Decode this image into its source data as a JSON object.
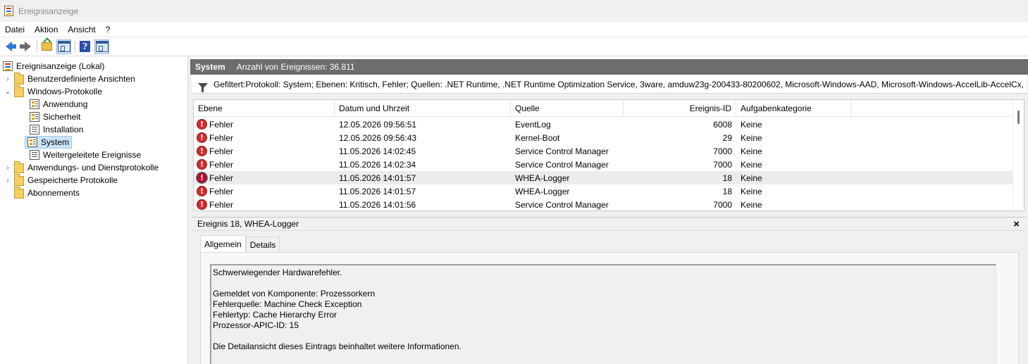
{
  "window": {
    "title": "Ereignisanzeige"
  },
  "menu": [
    "Datei",
    "Aktion",
    "Ansicht",
    "?"
  ],
  "toolbar": {
    "icons": [
      "back-arrow-icon",
      "forward-arrow-icon",
      "up-folder-icon",
      "show-hide-tree-icon",
      "help-icon",
      "action-pane-icon"
    ]
  },
  "tree": {
    "root": "Ereignisanzeige (Lokal)",
    "custom_views": "Benutzerdefinierte Ansichten",
    "windows_logs": "Windows-Protokolle",
    "logs": [
      "Anwendung",
      "Sicherheit",
      "Installation",
      "System",
      "Weitergeleitete Ereignisse"
    ],
    "app_service_logs": "Anwendungs- und Dienstprotokolle",
    "saved_logs": "Gespeicherte Protokolle",
    "subscriptions": "Abonnements"
  },
  "panel": {
    "title": "System",
    "count_label": "Anzahl von Ereignissen: 36.811",
    "filter_text": "Gefiltert:Protokoll: System; Ebenen: Kritisch, Fehler; Quellen: .NET Runtime, .NET Runtime Optimization Service, 3ware, amduw23g-200433-80200602, Microsoft-Windows-AAD, Microsoft-Windows-AccelLib-AccelCx,"
  },
  "table": {
    "columns": {
      "level": "Ebene",
      "datetime": "Datum und Uhrzeit",
      "source": "Quelle",
      "event_id": "Ereignis-ID",
      "category": "Aufgabenkategorie"
    },
    "rows": [
      {
        "level": "Fehler",
        "datetime": "12.05.2026 09:56:51",
        "source": "EventLog",
        "event_id": "6008",
        "category": "Keine"
      },
      {
        "level": "Fehler",
        "datetime": "12.05.2026 09:56:43",
        "source": "Kernel-Boot",
        "event_id": "29",
        "category": "Keine"
      },
      {
        "level": "Fehler",
        "datetime": "11.05.2026 14:02:45",
        "source": "Service Control Manager",
        "event_id": "7000",
        "category": "Keine"
      },
      {
        "level": "Fehler",
        "datetime": "11.05.2026 14:02:34",
        "source": "Service Control Manager",
        "event_id": "7000",
        "category": "Keine"
      },
      {
        "level": "Fehler",
        "datetime": "11.05.2026 14:01:57",
        "source": "WHEA-Logger",
        "event_id": "18",
        "category": "Keine"
      },
      {
        "level": "Fehler",
        "datetime": "11.05.2026 14:01:57",
        "source": "WHEA-Logger",
        "event_id": "18",
        "category": "Keine"
      },
      {
        "level": "Fehler",
        "datetime": "11.05.2026 14:01:56",
        "source": "Service Control Manager",
        "event_id": "7000",
        "category": "Keine"
      }
    ]
  },
  "detail": {
    "title": "Ereignis 18, WHEA-Logger",
    "close": "×",
    "tabs": {
      "general": "Allgemein",
      "details": "Details"
    },
    "message": {
      "line1": "Schwerwiegender Hardwarefehler.",
      "line2": "Gemeldet von Komponente: Prozessorkern",
      "line3": "Fehlerquelle: Machine Check Exception",
      "line4": "Fehlertyp: Cache Hierarchy Error",
      "line5": "Prozessor-APIC-ID: 15",
      "line6": "Die Detailansicht dieses Eintrags beinhaltet weitere Informationen."
    }
  }
}
